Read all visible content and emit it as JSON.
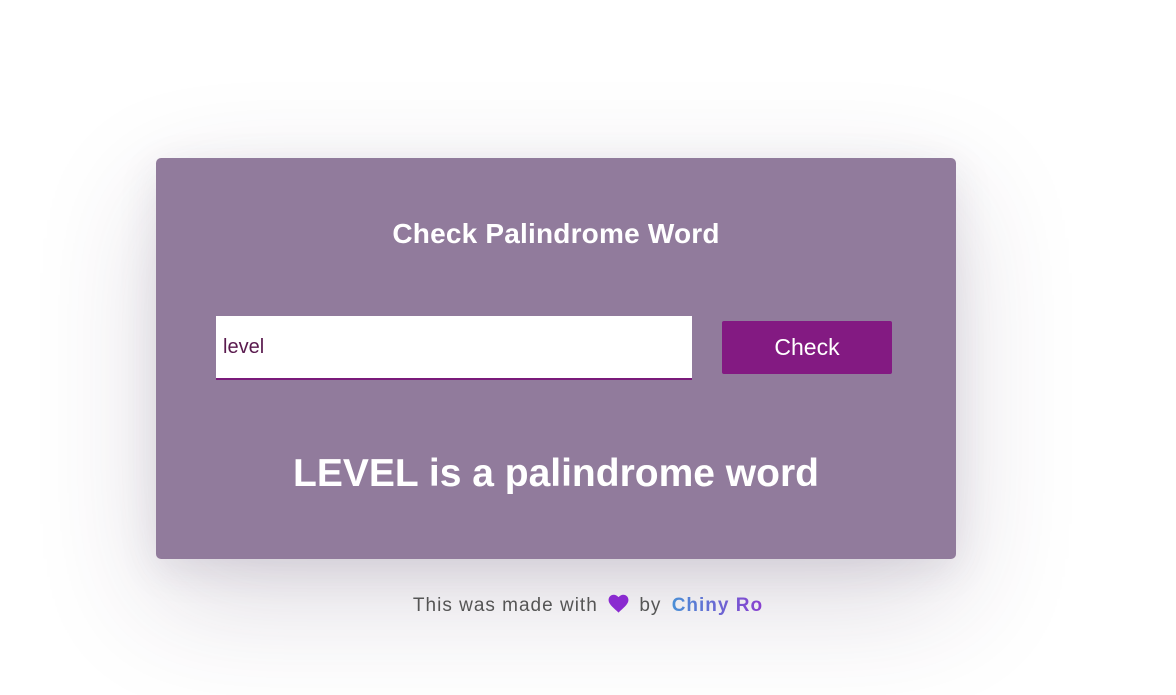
{
  "colors": {
    "card_background": "#917b9c",
    "button_background": "#831a82",
    "heart": "#8a2ad0",
    "input_border": "#7a1a7a"
  },
  "card": {
    "title": "Check Palindrome Word",
    "input_value": "level",
    "button_label": "Check",
    "result_text": "LEVEL is a palindrome word"
  },
  "footer": {
    "text_before": "This was made with",
    "heart_icon": "heart-icon",
    "text_by": "by",
    "author": "Chiny Ro"
  }
}
